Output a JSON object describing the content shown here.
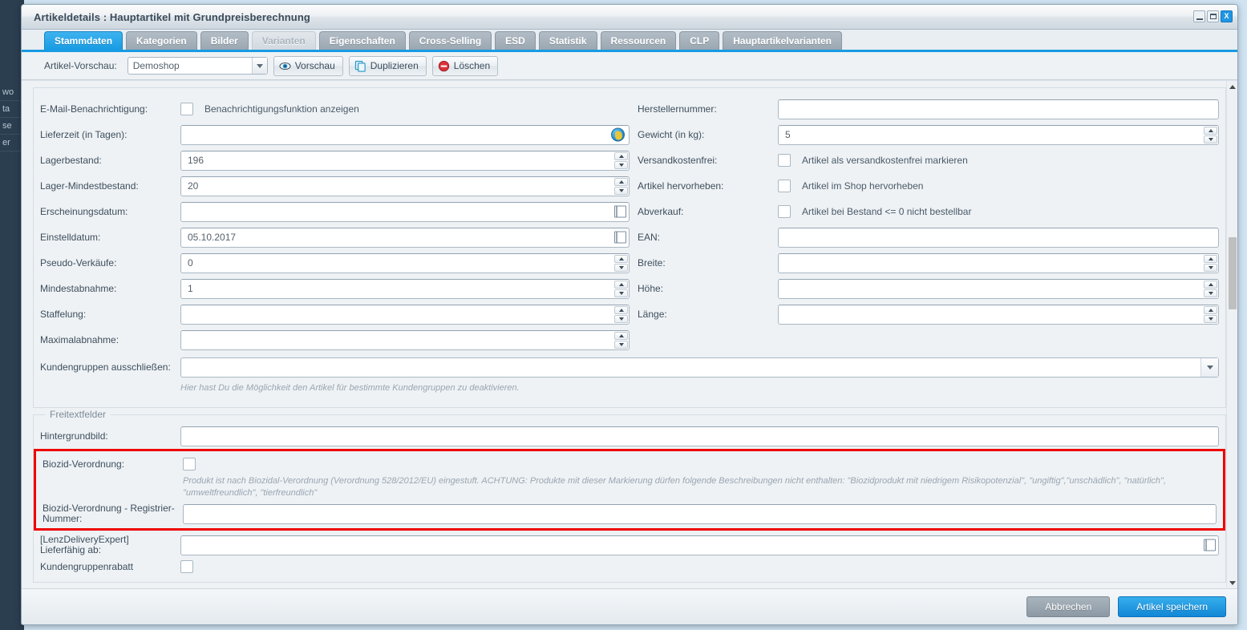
{
  "window": {
    "title": "Artikeldetails : Hauptartikel mit Grundpreisberechnung",
    "minimize_label": "_",
    "maximize_label": "□",
    "close_label": "X"
  },
  "tabs": [
    {
      "label": "Stammdaten",
      "state": "active"
    },
    {
      "label": "Kategorien",
      "state": "normal"
    },
    {
      "label": "Bilder",
      "state": "normal"
    },
    {
      "label": "Varianten",
      "state": "disabled"
    },
    {
      "label": "Eigenschaften",
      "state": "normal"
    },
    {
      "label": "Cross-Selling",
      "state": "normal"
    },
    {
      "label": "ESD",
      "state": "normal"
    },
    {
      "label": "Statistik",
      "state": "normal"
    },
    {
      "label": "Ressourcen",
      "state": "normal"
    },
    {
      "label": "CLP",
      "state": "normal"
    },
    {
      "label": "Hauptartikelvarianten",
      "state": "normal"
    }
  ],
  "toolbar": {
    "preview_label": "Artikel-Vorschau:",
    "shop_value": "Demoshop",
    "vorschau_label": "Vorschau",
    "duplizieren_label": "Duplizieren",
    "loeschen_label": "Löschen"
  },
  "left_column": {
    "email_notify_label": "E-Mail-Benachrichtigung:",
    "email_notify_checkbox_label": "Benachrichtigungsfunktion anzeigen",
    "lieferzeit_label": "Lieferzeit (in Tagen):",
    "lieferzeit_value": "",
    "lagerbestand_label": "Lagerbestand:",
    "lagerbestand_value": "196",
    "lager_min_label": "Lager-Mindestbestand:",
    "lager_min_value": "20",
    "erscheinungsdatum_label": "Erscheinungsdatum:",
    "erscheinungsdatum_value": "",
    "einstelldatum_label": "Einstelldatum:",
    "einstelldatum_value": "05.10.2017",
    "pseudo_label": "Pseudo-Verkäufe:",
    "pseudo_value": "0",
    "mindestabnahme_label": "Mindestabnahme:",
    "mindestabnahme_value": "1",
    "staffelung_label": "Staffelung:",
    "staffelung_value": "",
    "maximalabnahme_label": "Maximalabnahme:",
    "maximalabnahme_value": "",
    "kundengruppen_label": "Kundengruppen ausschließen:",
    "kundengruppen_value": "",
    "kundengruppen_hint": "Hier hast Du die Möglichkeit den Artikel für bestimmte Kundengruppen zu deaktivieren."
  },
  "right_column": {
    "herstellernummer_label": "Herstellernummer:",
    "herstellernummer_value": "",
    "gewicht_label": "Gewicht (in kg):",
    "gewicht_value": "5",
    "versandkostenfrei_label": "Versandkostenfrei:",
    "versandkostenfrei_checkbox_label": "Artikel als versandkostenfrei markieren",
    "hervorheben_label": "Artikel hervorheben:",
    "hervorheben_checkbox_label": "Artikel im Shop hervorheben",
    "abverkauf_label": "Abverkauf:",
    "abverkauf_checkbox_label": "Artikel bei Bestand <= 0 nicht bestellbar",
    "ean_label": "EAN:",
    "ean_value": "",
    "breite_label": "Breite:",
    "breite_value": "",
    "hoehe_label": "Höhe:",
    "hoehe_value": "",
    "laenge_label": "Länge:",
    "laenge_value": ""
  },
  "freitextfelder": {
    "legend": "Freitextfelder",
    "hintergrundbild_label": "Hintergrundbild:",
    "hintergrundbild_value": "",
    "biozid_label": "Biozid-Verordnung:",
    "biozid_hint": "Produkt ist nach Biozidal-Verordnung (Verordnung 528/2012/EU) eingestuft. ACHTUNG: Produkte mit dieser Markierung dürfen folgende Beschreibungen nicht enthalten: \"Biozidprodukt mit niedrigem Risikopotenzial\", \"ungiftig\",\"unschädlich\", \"natürlich\", \"umweltfreundlich\", \"tierfreundlich\"",
    "biozid_reg_label": "Biozid-Verordnung - Registrier-Nummer:",
    "biozid_reg_value": "",
    "lenz_label": "[LenzDeliveryExpert] Lieferfähig ab:",
    "lenz_value": "",
    "kundengruppenrabatt_label": "Kundengruppenrabatt"
  },
  "footer": {
    "cancel_label": "Abbrechen",
    "save_label": "Artikel speichern"
  },
  "background": {
    "nav_items": [
      "wo",
      "ta",
      "se",
      "er"
    ]
  },
  "colors": {
    "accent": "#189be3",
    "highlight_border": "#ef0000",
    "tab_inactive": "#9aa6b1",
    "save_button": "#1287d6"
  }
}
